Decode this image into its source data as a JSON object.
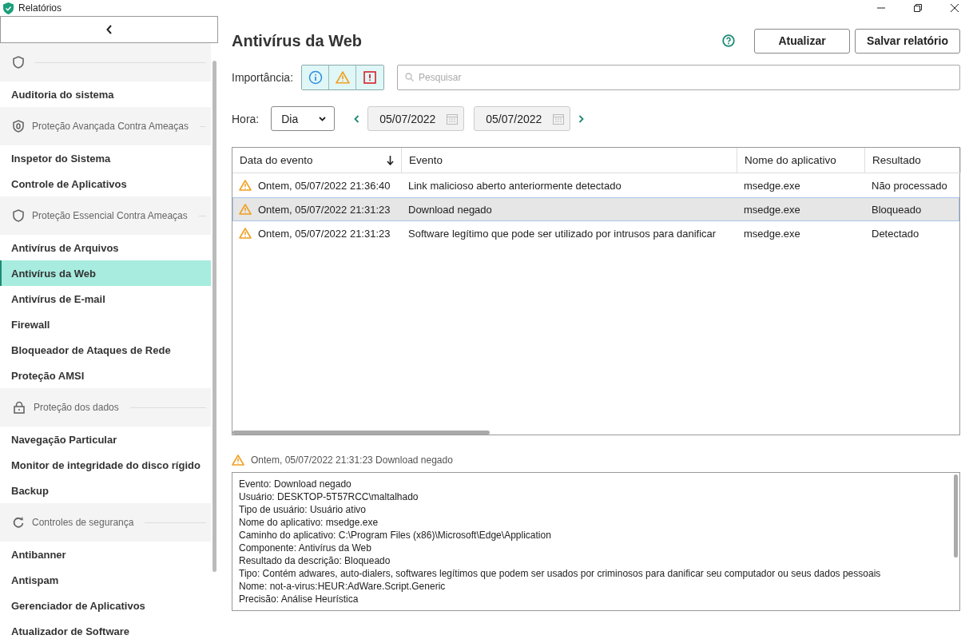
{
  "window": {
    "title": "Relatórios"
  },
  "sidebar": {
    "sections": [
      {
        "items": [
          {
            "label": "Auditoria do sistema",
            "selected": false
          }
        ]
      },
      {
        "title": "Proteção Avançada Contra Ameaças",
        "items": [
          {
            "label": "Inspetor do Sistema",
            "selected": false
          },
          {
            "label": "Controle de Aplicativos",
            "selected": false
          }
        ]
      },
      {
        "title": "Proteção Essencial Contra Ameaças",
        "items": [
          {
            "label": "Antivírus de Arquivos",
            "selected": false
          },
          {
            "label": "Antivírus da Web",
            "selected": true
          },
          {
            "label": "Antivírus de E-mail",
            "selected": false
          },
          {
            "label": "Firewall",
            "selected": false
          },
          {
            "label": "Bloqueador de Ataques de Rede",
            "selected": false
          },
          {
            "label": "Proteção AMSI",
            "selected": false
          }
        ]
      },
      {
        "title": "Proteção dos dados",
        "items": [
          {
            "label": "Navegação Particular",
            "selected": false
          },
          {
            "label": "Monitor de integridade do disco rígido",
            "selected": false
          },
          {
            "label": "Backup",
            "selected": false
          }
        ]
      },
      {
        "title": "Controles de segurança",
        "items": [
          {
            "label": "Antibanner",
            "selected": false
          },
          {
            "label": "Antispam",
            "selected": false
          },
          {
            "label": "Gerenciador de Aplicativos",
            "selected": false
          },
          {
            "label": "Atualizador de Software",
            "selected": false
          }
        ]
      }
    ]
  },
  "header": {
    "title": "Antivírus da Web",
    "buttons": [
      "Atualizar",
      "Salvar relatório"
    ]
  },
  "filters": {
    "importance_label": "Importância:",
    "importance": [
      {
        "kind": "info",
        "selected": true
      },
      {
        "kind": "warning",
        "selected": true
      },
      {
        "kind": "critical",
        "selected": true
      }
    ],
    "search": {
      "placeholder": "Pesquisar"
    },
    "time_label": "Hora:",
    "period": "Dia",
    "date_from": "05/07/2022",
    "date_to": "05/07/2022"
  },
  "table": {
    "columns": [
      {
        "label": "Data do evento",
        "sorted": true
      },
      {
        "label": "Evento",
        "sorted": false
      },
      {
        "label": "Nome do aplicativo",
        "sorted": false
      },
      {
        "label": "Resultado",
        "sorted": false
      }
    ],
    "rows": [
      {
        "date": "Ontem, 05/07/2022 21:36:40",
        "event": "Link malicioso aberto anteriormente detectado",
        "app": "msedge.exe",
        "result": "Não processado",
        "selected": false
      },
      {
        "date": "Ontem, 05/07/2022 21:31:23",
        "event": "Download negado",
        "app": "msedge.exe",
        "result": "Bloqueado",
        "selected": true
      },
      {
        "date": "Ontem, 05/07/2022 21:31:23",
        "event": "Software legítimo que pode ser utilizado por intrusos para danificar",
        "app": "msedge.exe",
        "result": "Detectado",
        "selected": false
      }
    ]
  },
  "details": {
    "heading": "Ontem, 05/07/2022 21:31:23 Download negado",
    "lines": [
      "Evento: Download negado",
      "Usuário: DESKTOP-5T57RCC\\maltalhado",
      "Tipo de usuário: Usuário ativo",
      "Nome do aplicativo: msedge.exe",
      "Caminho do aplicativo: C:\\Program Files (x86)\\Microsoft\\Edge\\Application",
      "Componente: Antivírus da Web",
      "Resultado da descrição: Bloqueado",
      "Tipo: Contém adwares, auto-dialers, softwares legítimos que podem ser usados por criminosos para danificar seu computador ou seus dados pessoais",
      "Nome: not-a-virus:HEUR:AdWare.Script.Generic",
      "Precisão: Análise Heurística"
    ]
  }
}
